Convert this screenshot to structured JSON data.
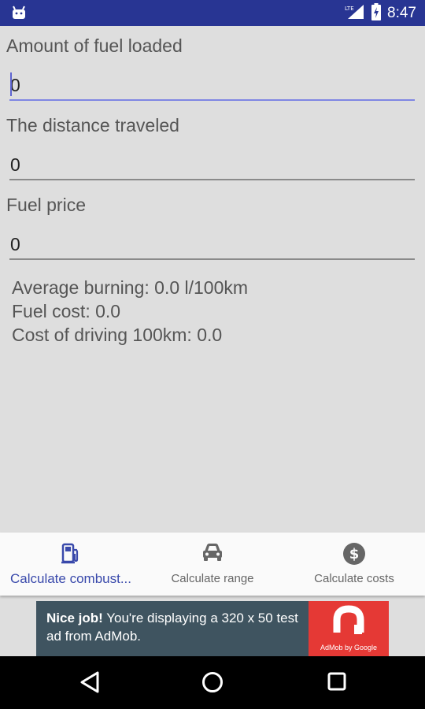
{
  "status_bar": {
    "time": "8:47",
    "network": "LTE",
    "icons": [
      "android-icon",
      "lte-signal-icon",
      "battery-charging-icon"
    ]
  },
  "form": {
    "fuel_label": "Amount of fuel loaded",
    "fuel_value": "0",
    "distance_label": "The distance traveled",
    "distance_value": "0",
    "price_label": "Fuel price",
    "price_value": "0"
  },
  "results": {
    "average_burning": "Average burning: 0.0 l/100km",
    "fuel_cost": "Fuel cost: 0.0",
    "cost_100km": "Cost of driving 100km: 0.0"
  },
  "bottom_nav": {
    "items": [
      {
        "label": "Calculate combust...",
        "icon": "fuel-pump-icon",
        "active": true
      },
      {
        "label": "Calculate range",
        "icon": "car-icon",
        "active": false
      },
      {
        "label": "Calculate costs",
        "icon": "dollar-icon",
        "active": false
      }
    ]
  },
  "ad": {
    "headline": "Nice job!",
    "body": "You're displaying a 320 x 50 test ad from AdMob.",
    "logo_text": "AdMob by Google"
  },
  "colors": {
    "status_bar": "#283593",
    "accent": "#3949ab",
    "background": "#dedede",
    "ad_background": "#3f5460",
    "ad_logo": "#e53935"
  }
}
